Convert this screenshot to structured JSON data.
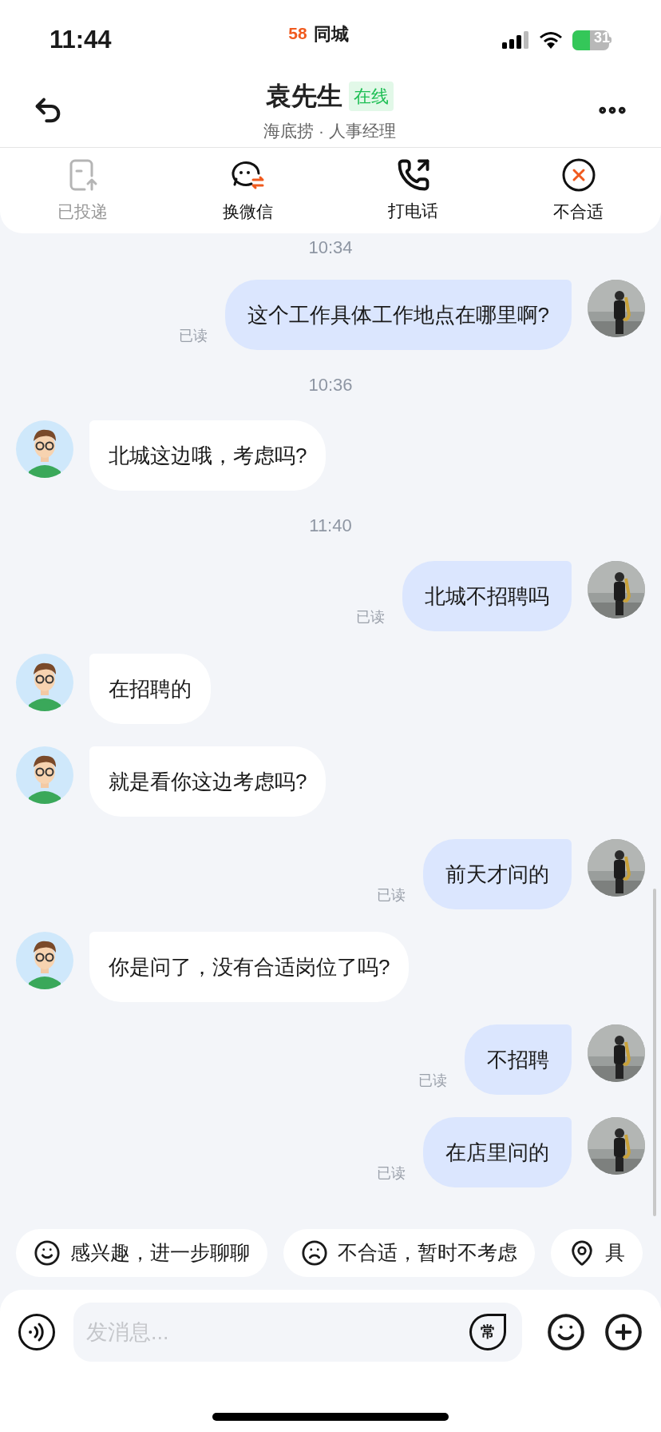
{
  "status_bar": {
    "time": "11:44",
    "app_logo": "58",
    "app_name": "同城",
    "battery": "31"
  },
  "header": {
    "name": "袁先生",
    "status_badge": "在线",
    "subtitle": "海底捞 · 人事经理"
  },
  "actions": [
    {
      "kind": "delivered",
      "label": "已投递",
      "disabled": true
    },
    {
      "kind": "wechat",
      "label": "换微信",
      "disabled": false
    },
    {
      "kind": "call",
      "label": "打电话",
      "disabled": false
    },
    {
      "kind": "reject",
      "label": "不合适",
      "disabled": false
    }
  ],
  "messages": [
    {
      "kind": "time",
      "text": "10:34"
    },
    {
      "kind": "sent",
      "text": "这个工作具体工作地点在哪里啊?",
      "receipt": "已读"
    },
    {
      "kind": "time",
      "text": "10:36"
    },
    {
      "kind": "received",
      "text": "北城这边哦，考虑吗?"
    },
    {
      "kind": "time",
      "text": "11:40"
    },
    {
      "kind": "sent",
      "text": "北城不招聘吗",
      "receipt": "已读"
    },
    {
      "kind": "received",
      "text": "在招聘的"
    },
    {
      "kind": "received",
      "text": "就是看你这边考虑吗?"
    },
    {
      "kind": "sent",
      "text": "前天才问的",
      "receipt": "已读"
    },
    {
      "kind": "received",
      "text": "你是问了，没有合适岗位了吗?"
    },
    {
      "kind": "sent",
      "text": "不招聘",
      "receipt": "已读"
    },
    {
      "kind": "sent",
      "text": "在店里问的",
      "receipt": "已读"
    }
  ],
  "quick_replies": [
    {
      "kind": "happy",
      "label": "感兴趣，进一步聊聊"
    },
    {
      "kind": "sad",
      "label": "不合适，暂时不考虑"
    },
    {
      "kind": "location",
      "label": "具"
    }
  ],
  "composer": {
    "placeholder": "发消息...",
    "phrases_button": "常"
  }
}
